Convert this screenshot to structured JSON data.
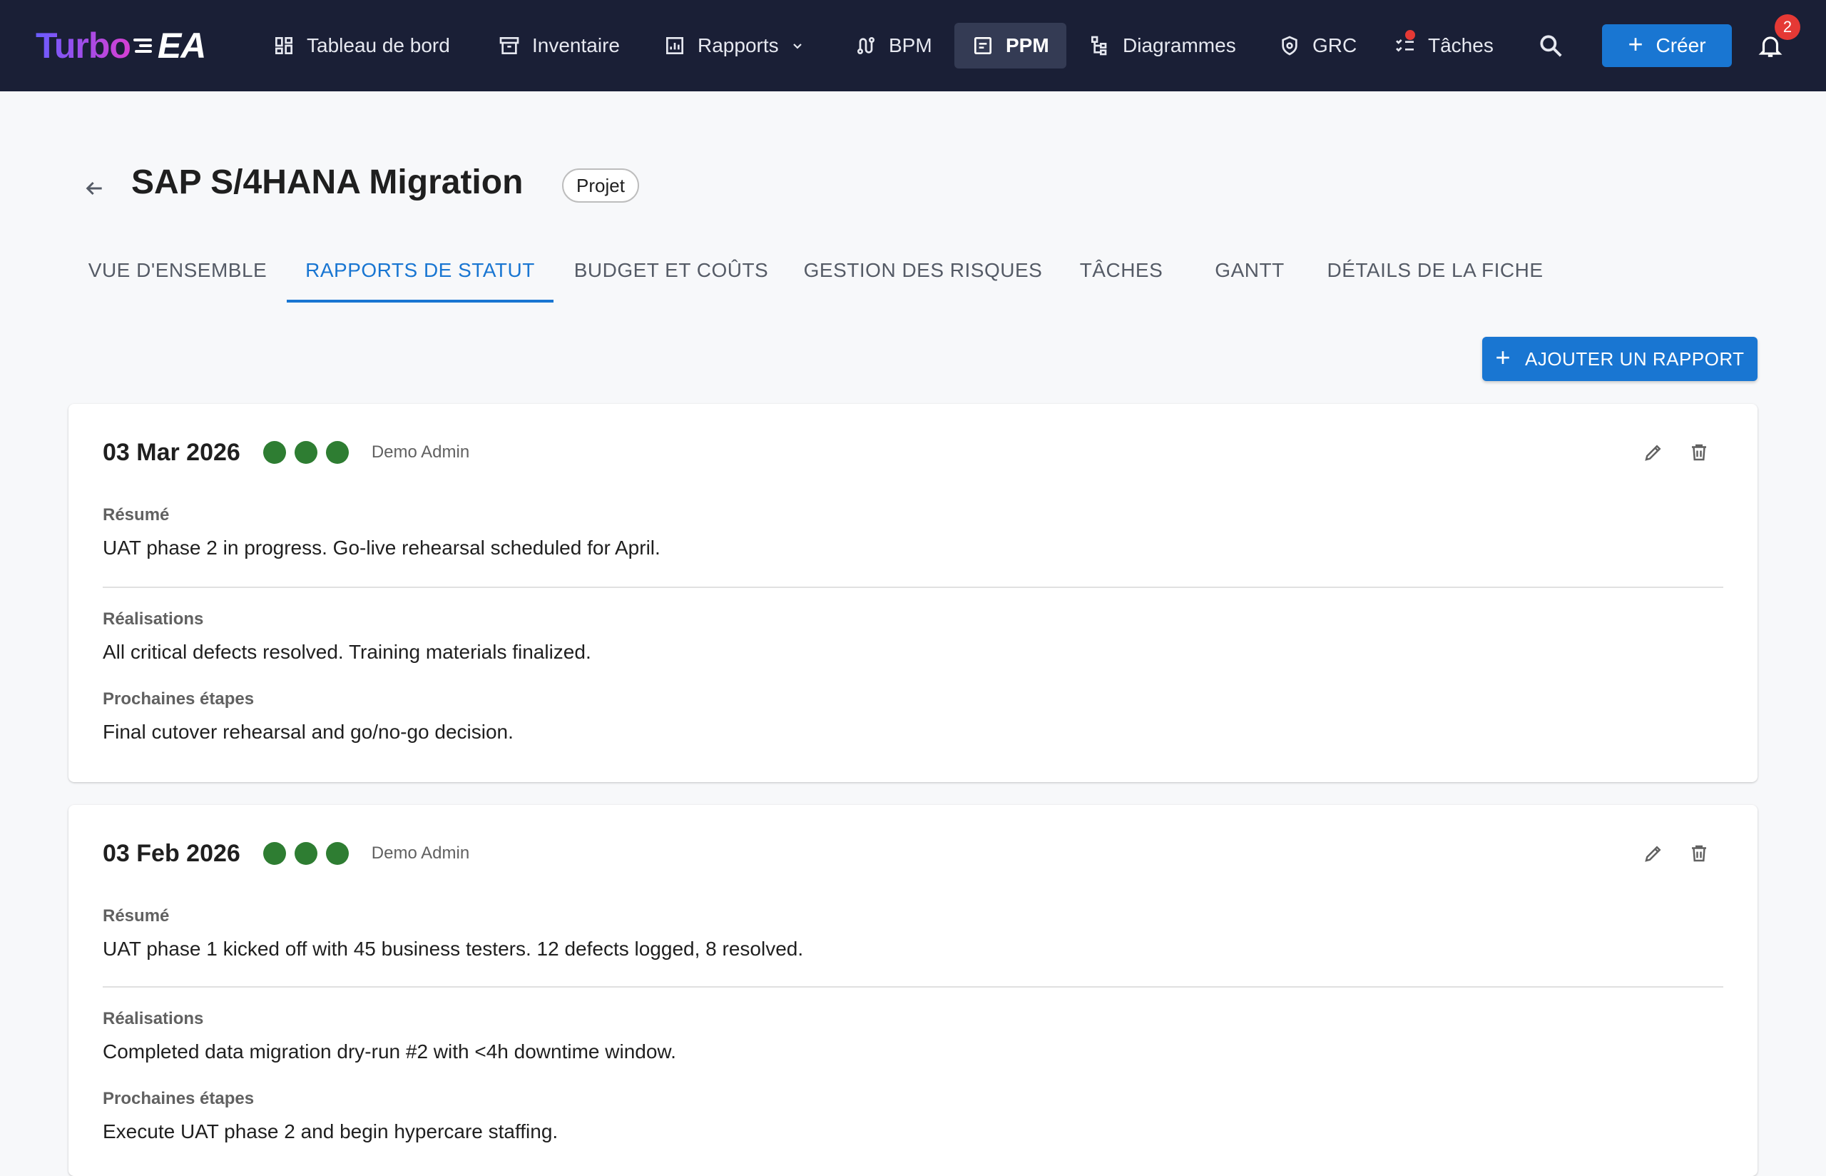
{
  "app": {
    "logo_part1": "Turbo",
    "logo_part2": "EA"
  },
  "nav": {
    "items": [
      {
        "label": "Tableau de bord",
        "icon": "dashboard-icon"
      },
      {
        "label": "Inventaire",
        "icon": "archive-icon"
      },
      {
        "label": "Rapports",
        "icon": "bar-chart-icon"
      },
      {
        "label": "BPM",
        "icon": "route-icon"
      },
      {
        "label": "PPM",
        "icon": "project-icon",
        "active": true
      },
      {
        "label": "Diagrammes",
        "icon": "hierarchy-icon"
      },
      {
        "label": "GRC",
        "icon": "shield-icon"
      },
      {
        "label": "Tâches",
        "icon": "checklist-icon"
      }
    ],
    "create_label": "Créer",
    "notification_count": "2"
  },
  "page": {
    "title": "SAP S/4HANA Migration",
    "type_chip": "Projet"
  },
  "tabs": [
    {
      "label": "VUE D'ENSEMBLE"
    },
    {
      "label": "RAPPORTS DE STATUT",
      "active": true
    },
    {
      "label": "BUDGET ET COÛTS"
    },
    {
      "label": "GESTION DES RISQUES"
    },
    {
      "label": "TÂCHES"
    },
    {
      "label": "GANTT"
    },
    {
      "label": "DÉTAILS DE LA FICHE"
    }
  ],
  "add_report_label": "AJOUTER UN RAPPORT",
  "status_color": "#2e7d32",
  "reports": [
    {
      "date": "03 Mar 2026",
      "author": "Demo Admin",
      "summary_label": "Résumé",
      "summary": "UAT phase 2 in progress. Go-live rehearsal scheduled for April.",
      "achievements_label": "Réalisations",
      "achievements": "All critical defects resolved. Training materials finalized.",
      "next_steps_label": "Prochaines étapes",
      "next_steps": "Final cutover rehearsal and go/no-go decision."
    },
    {
      "date": "03 Feb 2026",
      "author": "Demo Admin",
      "summary_label": "Résumé",
      "summary": "UAT phase 1 kicked off with 45 business testers. 12 defects logged, 8 resolved.",
      "achievements_label": "Réalisations",
      "achievements": "Completed data migration dry-run #2 with <4h downtime window.",
      "next_steps_label": "Prochaines étapes",
      "next_steps": "Execute UAT phase 2 and begin hypercare staffing."
    }
  ]
}
